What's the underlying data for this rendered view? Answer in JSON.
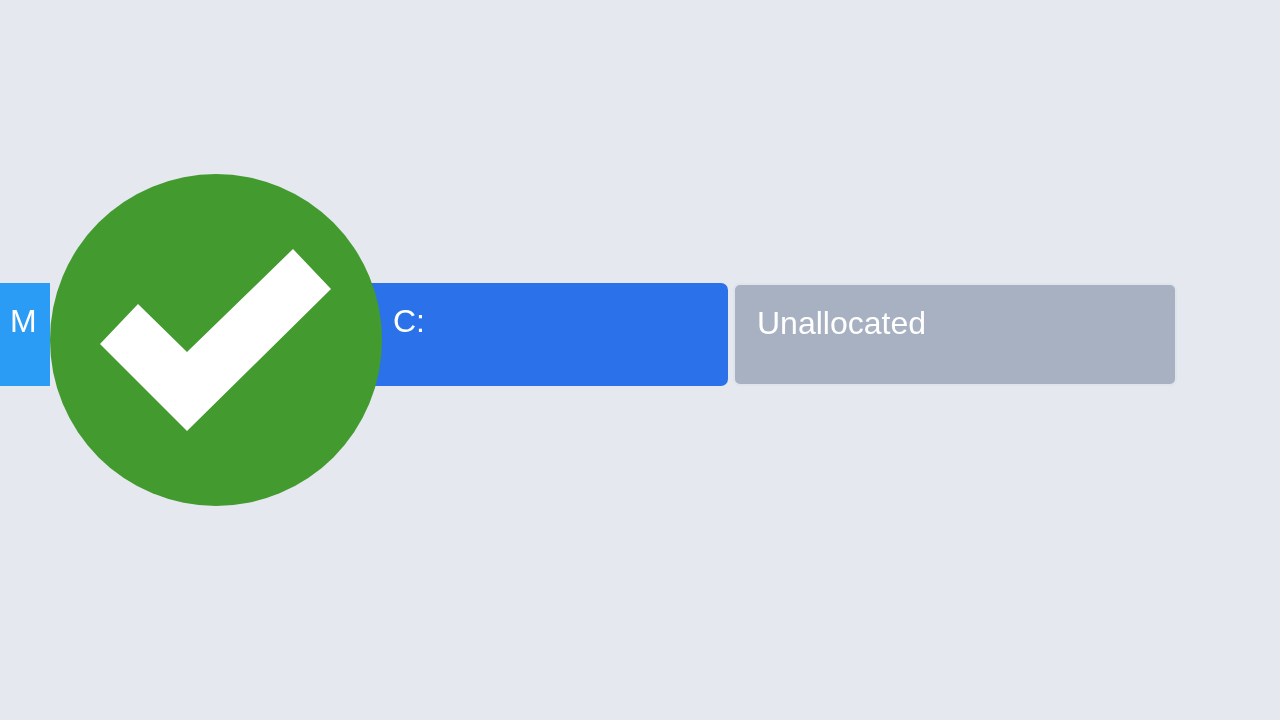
{
  "partitions": [
    {
      "label": "M",
      "color": "#2a9cf5"
    },
    {
      "label": "C:",
      "color": "#2b72ea"
    },
    {
      "label": "Unallocated",
      "color": "#a7b1c1"
    }
  ],
  "status": {
    "kind": "success"
  }
}
